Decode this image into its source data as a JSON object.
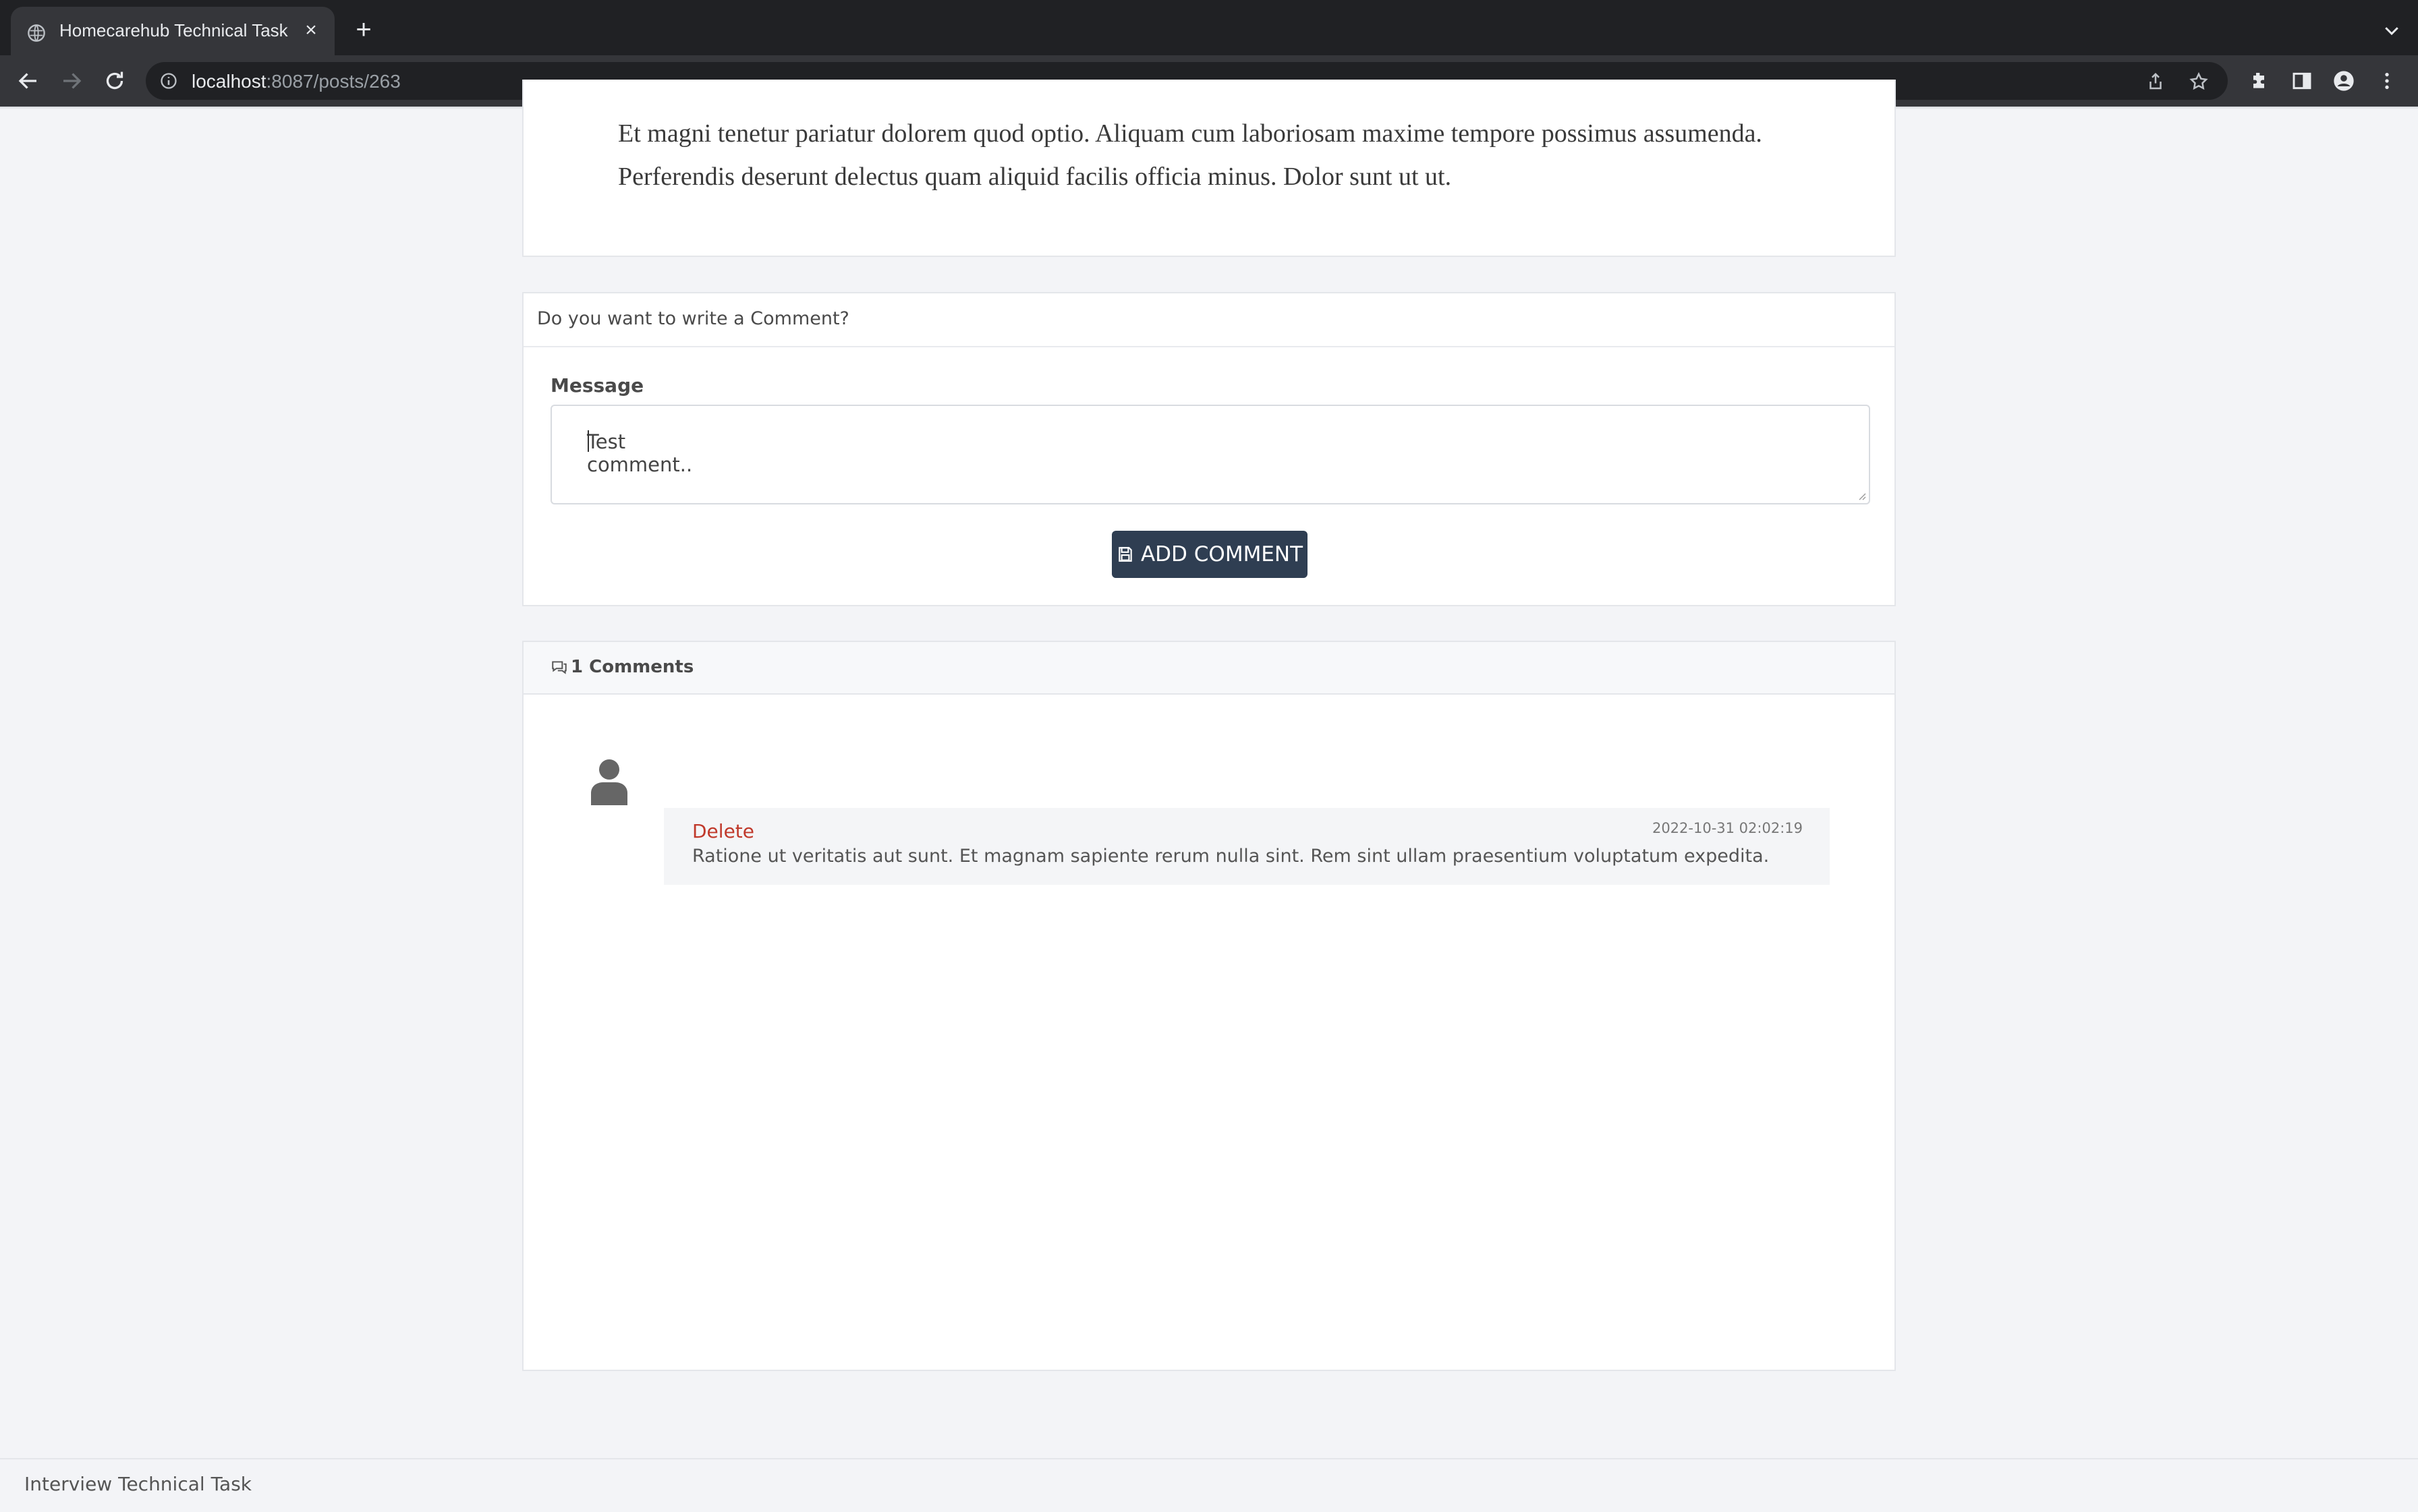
{
  "browser": {
    "tab_title": "Homecarehub Technical Task",
    "url_host": "localhost",
    "url_rest": ":8087/posts/263"
  },
  "post": {
    "text": "Et magni tenetur pariatur dolorem quod optio. Aliquam cum laboriosam maxime tempore possimus assumenda. Perferendis deserunt delectus quam aliquid facilis officia minus. Dolor sunt ut ut."
  },
  "comment_form": {
    "heading": "Do you want to write a Comment?",
    "message_label": "Message",
    "message_value": "Test comment..",
    "submit_label": "ADD COMMENT"
  },
  "comments": {
    "count_label": "1 Comments",
    "items": [
      {
        "delete_label": "Delete",
        "date": "2022-10-31 02:02:19",
        "text": "Ratione ut veritatis aut sunt. Et magnam sapiente rerum nulla sint. Rem sint ullam praesentium voluptatum expedita."
      }
    ]
  },
  "footer": {
    "text": "Interview Technical Task"
  },
  "colors": {
    "primary_button": "#2f3e52",
    "delete_link": "#c0392b"
  }
}
